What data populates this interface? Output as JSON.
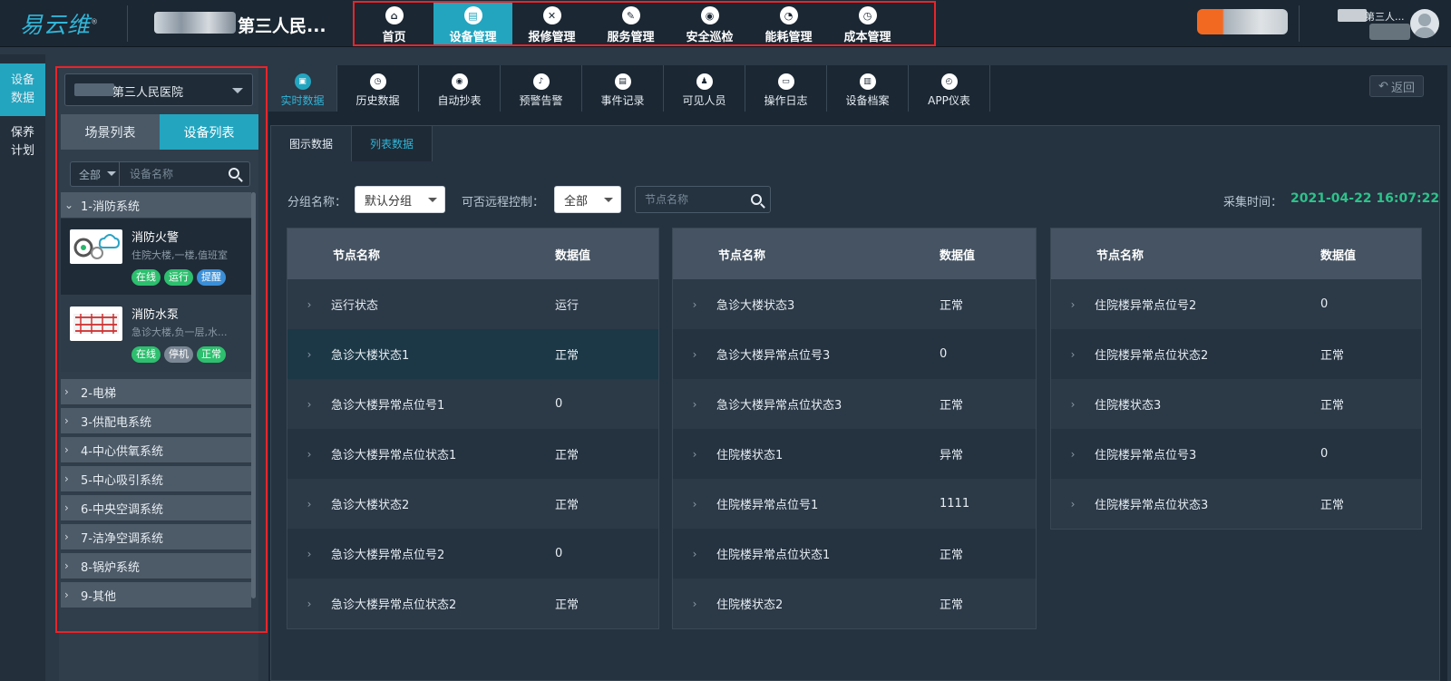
{
  "header": {
    "logo": "易云维",
    "logo_mark": "®",
    "hospital_name": "第三人民...",
    "nav": [
      {
        "label": "首页",
        "icon": "home-icon",
        "glyph": "⌂"
      },
      {
        "label": "设备管理",
        "icon": "device-icon",
        "glyph": "▤",
        "active": true
      },
      {
        "label": "报修管理",
        "icon": "tools-icon",
        "glyph": "✕"
      },
      {
        "label": "服务管理",
        "icon": "edit-icon",
        "glyph": "✎"
      },
      {
        "label": "安全巡检",
        "icon": "location-icon",
        "glyph": "◉"
      },
      {
        "label": "能耗管理",
        "icon": "pie-chart-icon",
        "glyph": "◔"
      },
      {
        "label": "成本管理",
        "icon": "stopwatch-icon",
        "glyph": "◷"
      }
    ],
    "user_name": "第三人..."
  },
  "rail": [
    {
      "label": "设备\n数据",
      "active": true
    },
    {
      "label": "保养\n计划",
      "active": false
    }
  ],
  "side": {
    "hospital_select": "第三人民医院",
    "tabs": [
      "场景列表",
      "设备列表"
    ],
    "filter_value": "全部",
    "search_placeholder": "设备名称",
    "groups_open": {
      "label": "1-消防系统"
    },
    "devices": [
      {
        "name": "消防火警",
        "location": "住院大楼,一楼,值班室",
        "badges": [
          {
            "label": "在线",
            "color": "#2dbf6e"
          },
          {
            "label": "运行",
            "color": "#2dbf6e"
          },
          {
            "label": "提醒",
            "color": "#3a8fd8"
          }
        ]
      },
      {
        "name": "消防水泵",
        "location": "急诊大楼,负一层,水...",
        "badges": [
          {
            "label": "在线",
            "color": "#2dbf6e"
          },
          {
            "label": "停机",
            "color": "#7b8794"
          },
          {
            "label": "正常",
            "color": "#2dbf6e"
          }
        ]
      }
    ],
    "groups": [
      "2-电梯",
      "3-供配电系统",
      "4-中心供氧系统",
      "5-中心吸引系统",
      "6-中央空调系统",
      "7-洁净空调系统",
      "8-锅炉系统",
      "9-其他"
    ]
  },
  "subtabs": [
    {
      "label": "实时数据",
      "glyph": "▣",
      "active": true
    },
    {
      "label": "历史数据",
      "glyph": "◷"
    },
    {
      "label": "自动抄表",
      "glyph": "◉"
    },
    {
      "label": "预警告警",
      "glyph": "♪"
    },
    {
      "label": "事件记录",
      "glyph": "▤"
    },
    {
      "label": "可见人员",
      "glyph": "♟"
    },
    {
      "label": "操作日志",
      "glyph": "▭"
    },
    {
      "label": "设备档案",
      "glyph": "▥"
    },
    {
      "label": "APP仪表",
      "glyph": "◴"
    }
  ],
  "back_label": "返回",
  "view_tabs": [
    "图示数据",
    "列表数据"
  ],
  "filters": {
    "group_label": "分组名称：",
    "group_value": "默认分组",
    "remote_label": "可否远程控制：",
    "remote_value": "全部",
    "node_placeholder": "节点名称",
    "time_label": "采集时间：",
    "time_value": "2021-04-22 16:07:22"
  },
  "table_headers": {
    "name": "节点名称",
    "value": "数据值"
  },
  "tables": [
    [
      {
        "name": "运行状态",
        "value": "运行"
      },
      {
        "name": "急诊大楼状态1",
        "value": "正常"
      },
      {
        "name": "急诊大楼异常点位号1",
        "value": "0"
      },
      {
        "name": "急诊大楼异常点位状态1",
        "value": "正常"
      },
      {
        "name": "急诊大楼状态2",
        "value": "正常"
      },
      {
        "name": "急诊大楼异常点位号2",
        "value": "0"
      },
      {
        "name": "急诊大楼异常点位状态2",
        "value": "正常"
      }
    ],
    [
      {
        "name": "急诊大楼状态3",
        "value": "正常"
      },
      {
        "name": "急诊大楼异常点位号3",
        "value": "0"
      },
      {
        "name": "急诊大楼异常点位状态3",
        "value": "正常"
      },
      {
        "name": "住院楼状态1",
        "value": "异常"
      },
      {
        "name": "住院楼异常点位号1",
        "value": "1111"
      },
      {
        "name": "住院楼异常点位状态1",
        "value": "正常"
      },
      {
        "name": "住院楼状态2",
        "value": "正常"
      }
    ],
    [
      {
        "name": "住院楼异常点位号2",
        "value": "0"
      },
      {
        "name": "住院楼异常点位状态2",
        "value": "正常"
      },
      {
        "name": "住院楼状态3",
        "value": "正常"
      },
      {
        "name": "住院楼异常点位号3",
        "value": "0"
      },
      {
        "name": "住院楼异常点位状态3",
        "value": "正常"
      }
    ]
  ],
  "colors": {
    "accent": "#23a5bf",
    "highlight_border": "#e8242a",
    "timestamp": "#2dc28a"
  }
}
